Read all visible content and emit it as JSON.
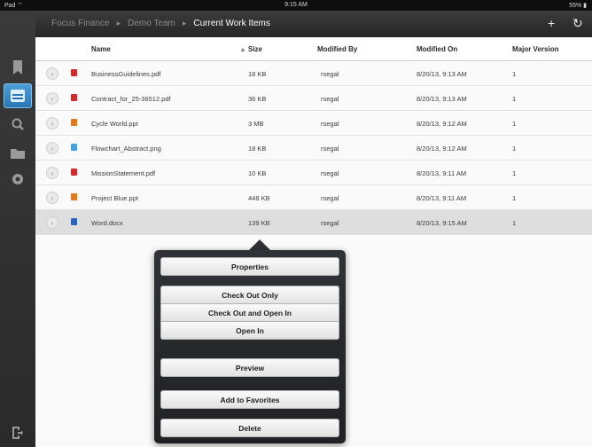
{
  "status_bar": {
    "left": "Pad ⌔",
    "time": "9:15 AM",
    "battery": "55% ▮"
  },
  "breadcrumb": [
    "Focus Finance",
    "Demo Team",
    "Current Work Items"
  ],
  "nav_icons": {
    "add": "+",
    "refresh": "↻"
  },
  "table": {
    "headers": [
      "Name",
      "Size",
      "Modified By",
      "Modified On",
      "Major Version"
    ],
    "sort_indicator": "▴",
    "rows": [
      {
        "name": "BusinessGuidelines.pdf",
        "size": "18 KB",
        "by": "rsegal",
        "on": "8/20/13, 9:13 AM",
        "version": "1",
        "type": "pdf"
      },
      {
        "name": "Contract_for_25-36512.pdf",
        "size": "36 KB",
        "by": "rsegal",
        "on": "8/20/13, 9:13 AM",
        "version": "1",
        "type": "pdf"
      },
      {
        "name": "Cycle World.ppt",
        "size": "3 MB",
        "by": "rsegal",
        "on": "8/20/13, 9:12 AM",
        "version": "1",
        "type": "ppt"
      },
      {
        "name": "Flowchart_Abstract.png",
        "size": "18 KB",
        "by": "rsegal",
        "on": "8/20/13, 9:12 AM",
        "version": "1",
        "type": "png"
      },
      {
        "name": "MissionStatement.pdf",
        "size": "10 KB",
        "by": "rsegal",
        "on": "8/20/13, 9:11 AM",
        "version": "1",
        "type": "pdf"
      },
      {
        "name": "Project Blue.ppt",
        "size": "448 KB",
        "by": "rsegal",
        "on": "8/20/13, 9:11 AM",
        "version": "1",
        "type": "ppt"
      },
      {
        "name": "Word.docx",
        "size": "139 KB",
        "by": "rsegal",
        "on": "8/20/13, 9:15 AM",
        "version": "1",
        "type": "docx"
      }
    ]
  },
  "popover_menu": {
    "properties": "Properties",
    "check_out_only": "Check Out Only",
    "check_out_open_in": "Check Out and Open In",
    "open_in": "Open In",
    "preview": "Preview",
    "add_to_favorites": "Add to Favorites",
    "delete": "Delete"
  },
  "colors": {
    "accent": "#2a73b3",
    "pdf": "#d12c2c",
    "ppt": "#e07a22",
    "png": "#4aa0dc",
    "docx": "#2b63b8"
  }
}
